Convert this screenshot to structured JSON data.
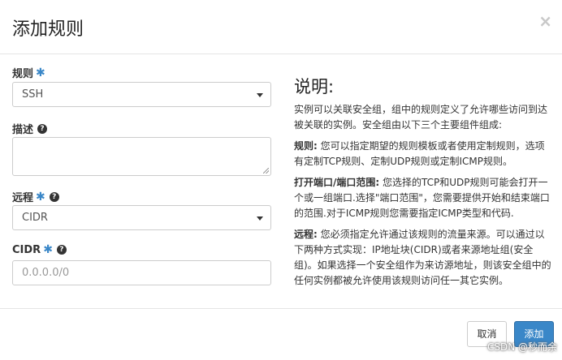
{
  "dialog": {
    "title": "添加规则",
    "close_glyph": "×"
  },
  "form": {
    "rule": {
      "label": "规则",
      "required_mark": "✱",
      "value": "SSH"
    },
    "description": {
      "label": "描述",
      "help_glyph": "?",
      "value": ""
    },
    "remote": {
      "label": "远程",
      "required_mark": "✱",
      "help_glyph": "?",
      "value": "CIDR"
    },
    "cidr": {
      "label": "CIDR",
      "required_mark": "✱",
      "help_glyph": "?",
      "placeholder": "0.0.0.0/0"
    }
  },
  "help_panel": {
    "heading": "说明:",
    "intro": "实例可以关联安全组，组中的规则定义了允许哪些访问到达被关联的实例。安全组由以下三个主要组件组成:",
    "rule_title": "规则:",
    "rule_text": "您可以指定期望的规则模板或者使用定制规则，选项有定制TCP规则、定制UDP规则或定制ICMP规则。",
    "port_title": "打开端口/端口范围:",
    "port_text": "您选择的TCP和UDP规则可能会打开一个或一组端口.选择\"端口范围\"，您需要提供开始和结束端口的范围.对于ICMP规则您需要指定ICMP类型和代码.",
    "remote_title": "远程:",
    "remote_text": "您必须指定允许通过该规则的流量来源。可以通过以下两种方式实现：IP地址块(CIDR)或者来源地址组(安全组)。如果选择一个安全组作为来访源地址，则该安全组中的任何实例都被允许使用该规则访问任一其它实例。"
  },
  "footer": {
    "cancel_label": "取消",
    "add_label": "添加"
  },
  "watermark": "CSDN @秒而余",
  "colors": {
    "primary": "#3a87c8",
    "required": "#3a87c8",
    "border": "#cccccc"
  }
}
